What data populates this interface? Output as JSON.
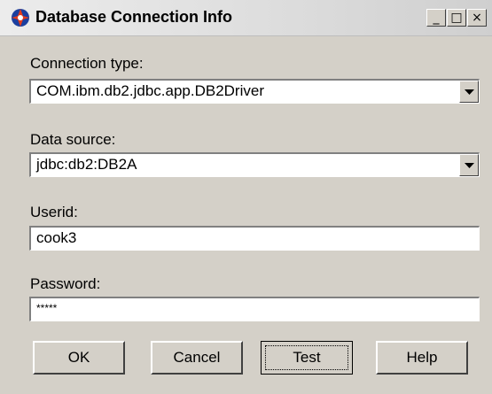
{
  "window": {
    "title": "Database Connection Info",
    "min_glyph": "_",
    "max_glyph": "□",
    "close_glyph": "×"
  },
  "connection_type": {
    "label": "Connection type:",
    "value": "COM.ibm.db2.jdbc.app.DB2Driver"
  },
  "data_source": {
    "label": "Data source:",
    "value": "jdbc:db2:DB2A"
  },
  "userid": {
    "label": "Userid:",
    "value": "cook3"
  },
  "password": {
    "label": "Password:",
    "value": "*****"
  },
  "buttons": {
    "ok": "OK",
    "cancel": "Cancel",
    "test": "Test",
    "help": "Help"
  },
  "icons": {
    "app": "app-icon",
    "dropdown": "chevron-down-icon"
  },
  "colors": {
    "dialog_bg": "#d4d0c8",
    "field_bg": "#ffffff"
  }
}
